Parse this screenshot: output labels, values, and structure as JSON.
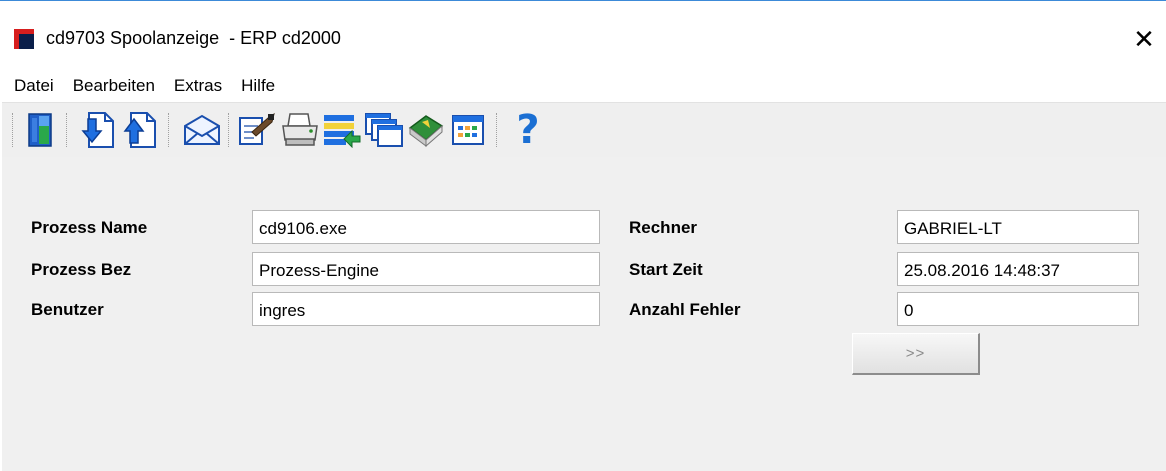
{
  "window": {
    "title": "cd9703 Spoolanzeige  - ERP cd2000",
    "close_symbol": "✕"
  },
  "menu": {
    "items": [
      "Datei",
      "Bearbeiten",
      "Extras",
      "Hilfe"
    ]
  },
  "toolbar": {
    "buttons": [
      {
        "icon": "exit-door-icon"
      },
      {
        "icon": "page-down-icon"
      },
      {
        "icon": "page-up-icon"
      },
      {
        "icon": "envelope-icon"
      },
      {
        "icon": "edit-document-icon"
      },
      {
        "icon": "printer-icon"
      },
      {
        "icon": "list-transfer-icon"
      },
      {
        "icon": "windows-stack-icon"
      },
      {
        "icon": "book-icon"
      },
      {
        "icon": "grid-table-icon"
      },
      {
        "icon": "help-icon"
      }
    ],
    "help_glyph": "?"
  },
  "form": {
    "prozess_name": {
      "label": "Prozess Name",
      "value": "cd9106.exe"
    },
    "prozess_bez": {
      "label": "Prozess Bez",
      "value": "Prozess-Engine"
    },
    "benutzer": {
      "label": "Benutzer",
      "value": "ingres"
    },
    "rechner": {
      "label": "Rechner",
      "value": "GABRIEL-LT"
    },
    "start_zeit": {
      "label": "Start Zeit",
      "value": "25.08.2016 14:48:37"
    },
    "anzahl_fehler": {
      "label": "Anzahl Fehler",
      "value": "0"
    },
    "next_button_label": ">>"
  },
  "colors": {
    "window_border": "#3c8ad8",
    "client_bg": "#f0f0f0",
    "icon_blue": "#1e6fd9",
    "help_blue": "#1b6fd3"
  }
}
